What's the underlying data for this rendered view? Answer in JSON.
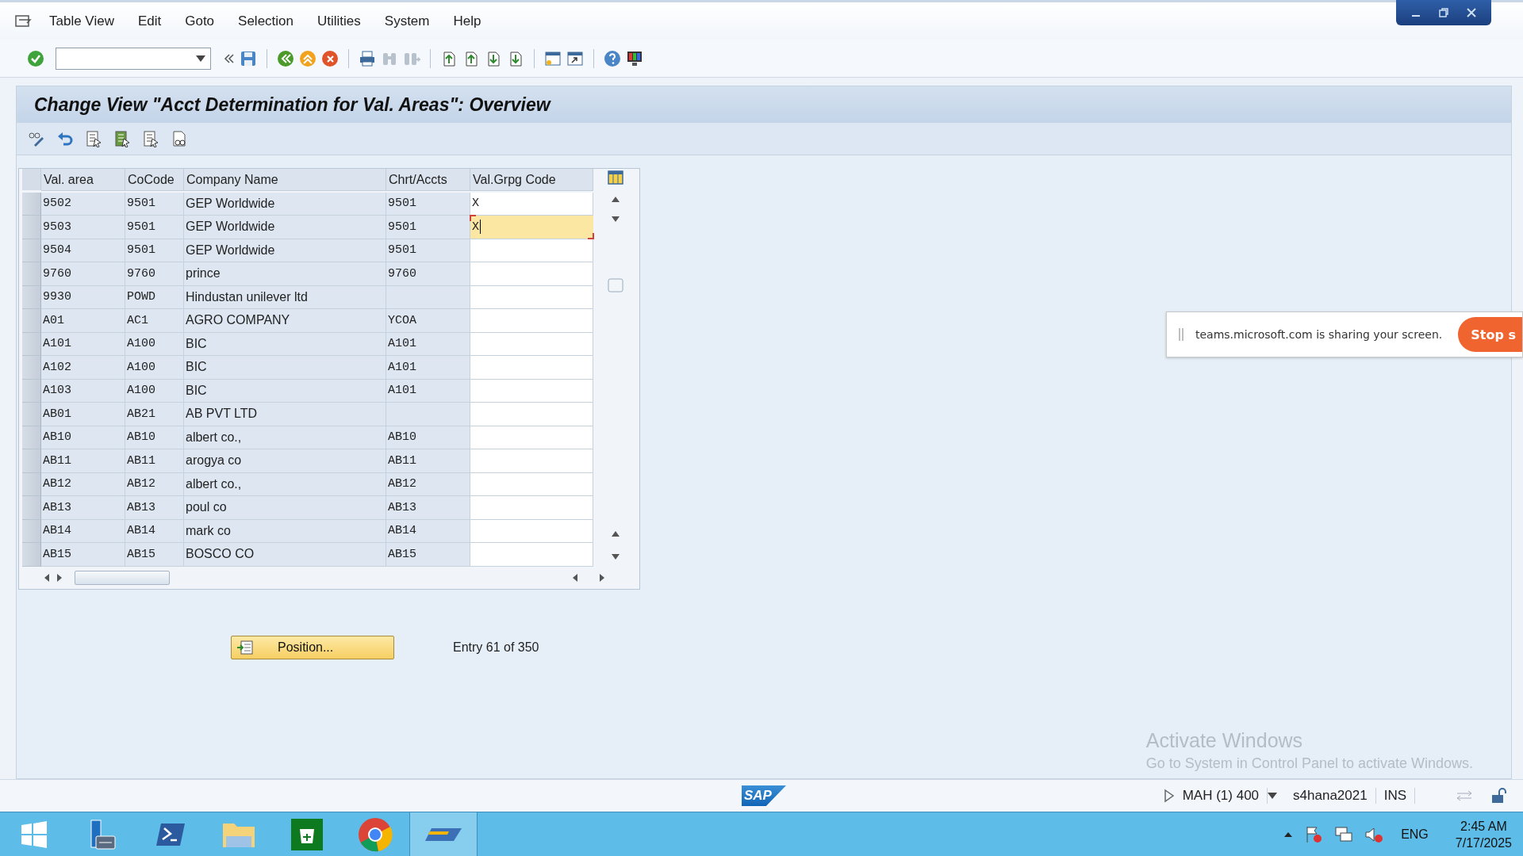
{
  "menu": {
    "items": [
      "Table View",
      "Edit",
      "Goto",
      "Selection",
      "Utilities",
      "System",
      "Help"
    ]
  },
  "title": "Change View \"Acct Determination for Val. Areas\": Overview",
  "table": {
    "columns": [
      "Val. area",
      "CoCode",
      "Company Name",
      "Chrt/Accts",
      "Val.Grpg Code"
    ],
    "rows": [
      {
        "cells": [
          "9502",
          "9501",
          "GEP Worldwide",
          "9501",
          "X"
        ],
        "editing": false
      },
      {
        "cells": [
          "9503",
          "9501",
          "GEP Worldwide",
          "9501",
          "X"
        ],
        "editing": true
      },
      {
        "cells": [
          "9504",
          "9501",
          "GEP Worldwide",
          "9501",
          null
        ],
        "editing": false
      },
      {
        "cells": [
          "9760",
          "9760",
          "prince",
          "9760",
          null
        ],
        "editing": false
      },
      {
        "cells": [
          "9930",
          "POWD",
          "Hindustan unilever ltd",
          null,
          null
        ],
        "editing": false
      },
      {
        "cells": [
          "A01",
          "AC1",
          "AGRO COMPANY",
          "YCOA",
          null
        ],
        "editing": false
      },
      {
        "cells": [
          "A101",
          "A100",
          "BIC",
          "A101",
          null
        ],
        "editing": false
      },
      {
        "cells": [
          "A102",
          "A100",
          "BIC",
          "A101",
          null
        ],
        "editing": false
      },
      {
        "cells": [
          "A103",
          "A100",
          "BIC",
          "A101",
          null
        ],
        "editing": false
      },
      {
        "cells": [
          "AB01",
          "AB21",
          "AB PVT LTD",
          null,
          null
        ],
        "editing": false
      },
      {
        "cells": [
          "AB10",
          "AB10",
          "albert co.,",
          "AB10",
          null
        ],
        "editing": false
      },
      {
        "cells": [
          "AB11",
          "AB11",
          "arogya co",
          "AB11",
          null
        ],
        "editing": false
      },
      {
        "cells": [
          "AB12",
          "AB12",
          "albert co.,",
          "AB12",
          null
        ],
        "editing": false
      },
      {
        "cells": [
          "AB13",
          "AB13",
          "poul co",
          "AB13",
          null
        ],
        "editing": false
      },
      {
        "cells": [
          "AB14",
          "AB14",
          "mark co",
          "AB14",
          null
        ],
        "editing": false
      },
      {
        "cells": [
          "AB15",
          "AB15",
          "BOSCO CO",
          "AB15",
          null
        ],
        "editing": false
      }
    ]
  },
  "position_button": "Position...",
  "entry_info": "Entry 61 of 350",
  "notification": {
    "text": "teams.microsoft.com is sharing your screen.",
    "button": "Stop s"
  },
  "activation": {
    "title": "Activate Windows",
    "subtitle": "Go to System in Control Panel to activate Windows."
  },
  "status_bar": {
    "logo": "SAP",
    "system": "MAH (1) 400",
    "server": "s4hana2021",
    "mode": "INS"
  },
  "taskbar": {
    "language": "ENG",
    "time": "2:45 AM",
    "date": "7/17/2025"
  }
}
